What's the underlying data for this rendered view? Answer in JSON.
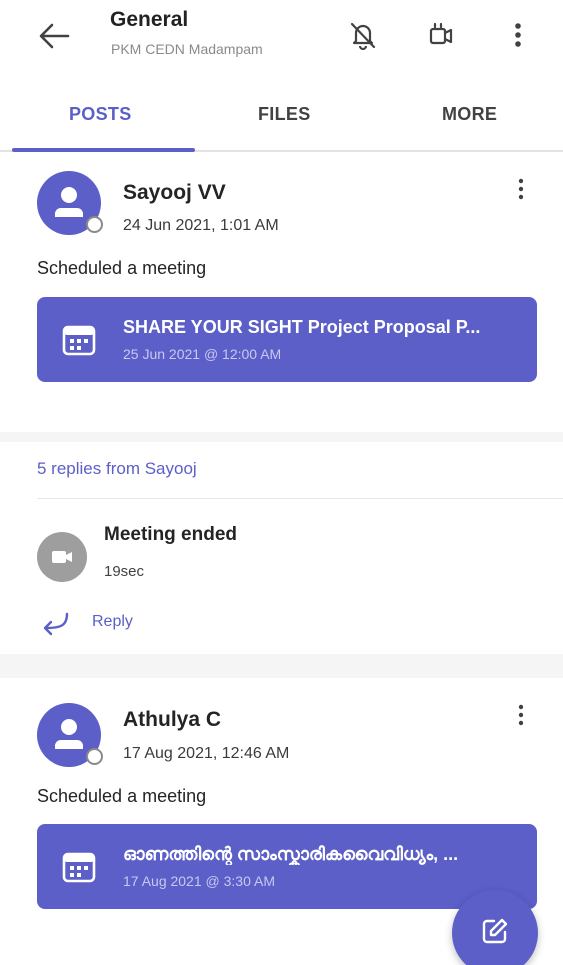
{
  "header": {
    "title": "General",
    "subtitle": "PKM CEDN Madampam",
    "icons": [
      "back-arrow-icon",
      "notifications-off-icon",
      "meet-now-icon",
      "more-options-icon"
    ]
  },
  "tabs": [
    {
      "label": "POSTS",
      "active": true
    },
    {
      "label": "FILES",
      "active": false
    },
    {
      "label": "MORE",
      "active": false
    }
  ],
  "posts": [
    {
      "author": "Sayooj VV",
      "timestamp": "24 Jun 2021, 1:01 AM",
      "action": "Scheduled a meeting",
      "meeting": {
        "title": "SHARE YOUR SIGHT Project Proposal P...",
        "date": "25 Jun 2021 @ 12:00 AM"
      },
      "replies_label": "5 replies from Sayooj",
      "latest_reply": {
        "title": "Meeting ended",
        "duration": "19sec"
      },
      "reply_label": "Reply"
    },
    {
      "author": "Athulya C",
      "timestamp": "17 Aug 2021, 12:46 AM",
      "action": "Scheduled a meeting",
      "meeting": {
        "title": "ഓണത്തിന്റെ സാംസ്കാരികവൈവിധ്യം, ...",
        "date": "17 Aug 2021 @ 3:30 AM"
      }
    }
  ],
  "colors": {
    "accent": "#5b5fc7",
    "background": "#ffffff",
    "band": "#f5f5f5"
  }
}
